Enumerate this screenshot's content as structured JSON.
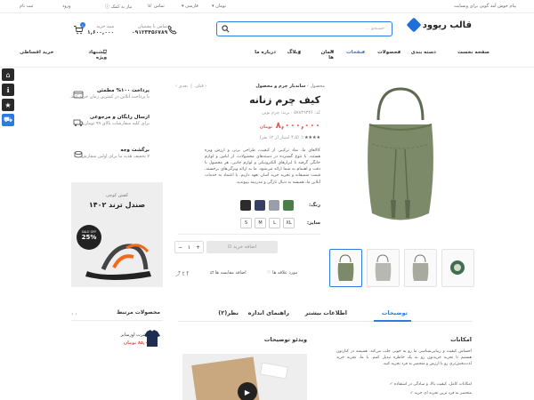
{
  "topbar": {
    "welcome": "پیام خوش آمد گویی برای وبسایت",
    "currency": "تومان",
    "language": "فارسی",
    "contact": "تماس",
    "help": "نیاز به کمک",
    "login": "ورود",
    "register": "ثبت نام"
  },
  "header": {
    "logo_text": "قالب ریوود",
    "search_placeholder": "جستجو ...",
    "support_label": "تماس با پشتیبان",
    "support_phone": "۰۹۱۲۳۴۵۶۷۸۹",
    "cart_label": "سبد خرید",
    "cart_total": "۱,۶۰۰,۰۰۰",
    "cart_count": "۱"
  },
  "nav": {
    "items": [
      "صفحه نخست",
      "دسته بندی",
      "محصولات",
      "صفحات",
      "المان ها",
      "وبلاگ",
      "درباره ما"
    ],
    "special": "پیشنهاد ویژه",
    "installment": "خرید اقساطی"
  },
  "breadcrumb": [
    "محصول",
    "ساندبار چرم و محصول"
  ],
  "pager": {
    "prev": "قبلی",
    "next": "بعدی"
  },
  "product": {
    "title": "کیف چرم زنانه",
    "sku": "کد: ۵۷۸۴۹۳۴۶",
    "brand": "برند: چرم نوین",
    "price": "۸,۰۰۰,۰۰۰",
    "old_price": "۹,۰۰۰,۰۰۰",
    "rating_text": "(۴.۵ امتیاز از ۱۲ نفر)",
    "description": "کالاهای ما، نماد ترکیبی از کیفیت، طراحی برتر، و ارزش ویژه هستند. با تنوع گسترده در دسته‌های محصولات، از لباس و لوازم خانگی گرفته تا ابزارهای الکترونیکی و لوازم جانبی، هر محصول با دقت و اهتمام به شما ارائه می‌شود. ما به ارائه ویژگی‌های برجسته، قیمت منصفانه و تجربه خرید آسان تعهد داریم. با اعتماد به خدمات آنلاین ما، همیشه به دنبال تازگی و مدرنیته بپیوندید.",
    "color_label": "رنگ:",
    "size_label": "سایز:",
    "colors": [
      "#2b2b2b",
      "#3a3f66",
      "#9a9ea8",
      "#4b7f49"
    ],
    "sizes": [
      "S",
      "M",
      "L",
      "XL"
    ],
    "quantity": "۱",
    "add_to_cart": "اضافه خرید",
    "wishlist": "مورد علاقه ها",
    "compare": "اضافه مقایسه ها"
  },
  "features": [
    {
      "title": "پرداخت ۱۰۰% مطمئن",
      "text": "با پرداخت آنلاین در کمترین زمان خرید کنید."
    },
    {
      "title": "ارسال رایگان و مرجوعی",
      "text": "برای کلیه سفارشات بالای ۹۹ تومان"
    },
    {
      "title": "برگشت وجه",
      "text": "۷ تخفیف هدیه ما برای اولین سفارش"
    }
  ],
  "banner": {
    "line1": "کفش کوچی",
    "line2": "صندل ترند ۱۴۰۲",
    "badge_top": "SALE OFF",
    "badge_value": "25%"
  },
  "related": {
    "title": "محصولات مرتبط",
    "item_name": "تی شرت اورسایز",
    "item_price": "۸۵,۰۰۰ تومان"
  },
  "tabs": [
    "توضیحات",
    "اطلاعات بیشتر",
    "راهنمای اندازه",
    "نظر(۲)"
  ],
  "features_section": {
    "title": "امکانات",
    "text": "احساس کیفیت و زیبایی‌شناسی ما رو به خوبی جلب می‌کند. همیشه در کنارتون هستیم تا تجربه خریدتون رو به یک خاطره تبدیل کنیم. با ما، تجربه خرید لذت‌بخش‌تری رو با ارزش و منحصر به فرد تجربه کنید.",
    "bullets": [
      "امکانات کامل، کیفیت بالا، و سادگی در استفاده",
      "متحصر به فرد ترین تجربه ای خرید"
    ]
  },
  "video_section": {
    "title": "ویدئو توضیحات"
  },
  "colors": {
    "accent": "#2d7be0",
    "price": "#e8534e",
    "bag": "#7d8a6a"
  }
}
